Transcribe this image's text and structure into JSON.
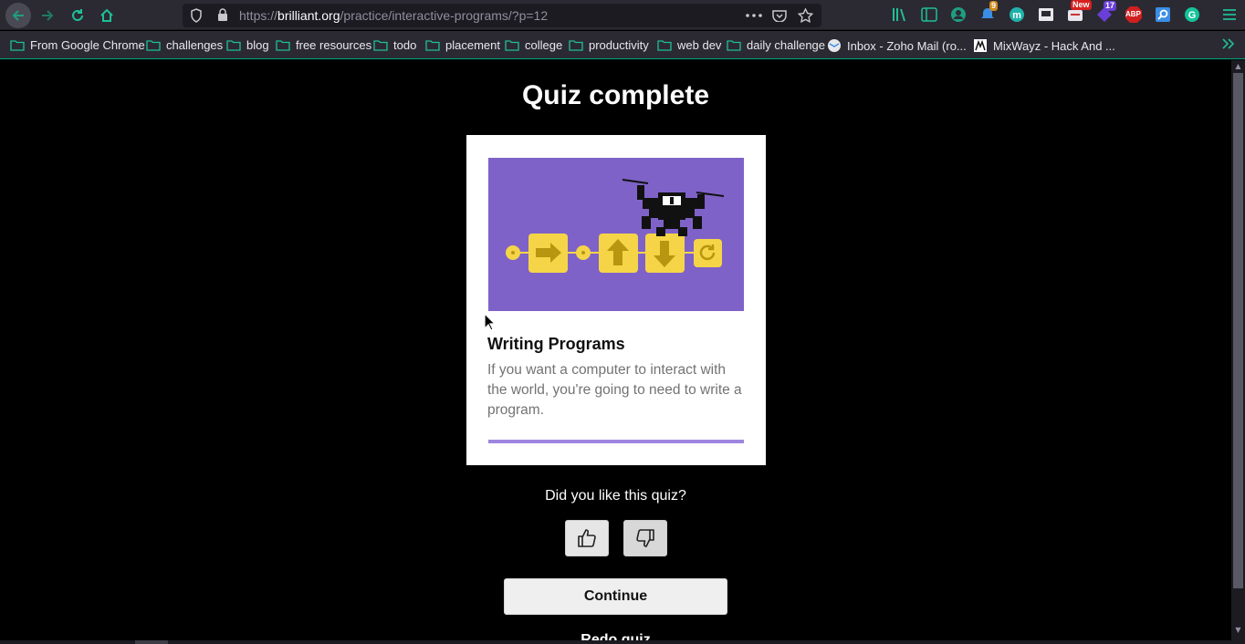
{
  "browser": {
    "url_prefix": "https://",
    "url_host": "brilliant.org",
    "url_path": "/practice/interactive-programs/?p=12",
    "icons": {
      "back": "back-arrow-icon",
      "forward": "forward-arrow-icon",
      "reload": "reload-icon",
      "home": "home-icon",
      "tracking": "shield-icon",
      "lock": "lock-icon",
      "more": "ellipsis-icon",
      "pocket": "pocket-icon",
      "bookmark": "star-icon",
      "menu": "hamburger-icon"
    },
    "extensions": {
      "badge_notifications": "9",
      "badge_new": "New",
      "badge_count": "17",
      "abp_label": "ABP"
    }
  },
  "bookmarks": [
    {
      "label": "From Google Chrome",
      "icon": "folder-icon"
    },
    {
      "label": "challenges",
      "icon": "folder-icon"
    },
    {
      "label": "blog",
      "icon": "folder-icon"
    },
    {
      "label": "free resources",
      "icon": "folder-icon"
    },
    {
      "label": "todo",
      "icon": "folder-icon"
    },
    {
      "label": "placement",
      "icon": "folder-icon"
    },
    {
      "label": "college",
      "icon": "folder-icon"
    },
    {
      "label": "productivity",
      "icon": "folder-icon"
    },
    {
      "label": "web dev",
      "icon": "folder-icon"
    },
    {
      "label": "daily challenge",
      "icon": "folder-icon"
    },
    {
      "label": "Inbox - Zoho Mail (ro...",
      "icon": "zoho-mail-icon"
    },
    {
      "label": "MixWayz - Hack And ...",
      "icon": "mixwayz-icon"
    }
  ],
  "page": {
    "title": "Quiz complete",
    "card": {
      "title": "Writing Programs",
      "description": "If you want a computer to interact with the world, you're going to need to write a program.",
      "progress_fraction": 1.0
    },
    "feedback_question": "Did you like this quiz?",
    "thumbs_up_icon": "thumbs-up-icon",
    "thumbs_down_icon": "thumbs-down-icon",
    "continue_label": "Continue",
    "redo_label": "Redo quiz"
  },
  "colors": {
    "accent": "#00a77f",
    "card_art_bg": "#7f62c8",
    "block_yellow": "#f5d547",
    "progress": "#9e85e0"
  }
}
